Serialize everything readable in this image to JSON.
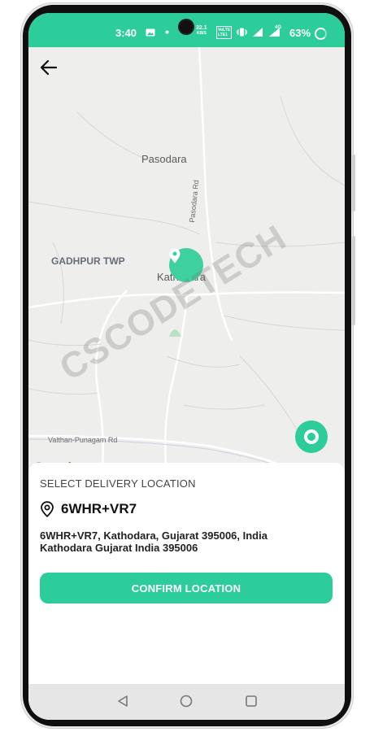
{
  "status_bar": {
    "time": "3:40",
    "network_speed_value": "32.1",
    "network_speed_unit": "KB/S",
    "volte_line1": "VoLTE",
    "volte_line2": "LTE1",
    "battery_percent": "63%",
    "icons": [
      "photo-icon",
      "dot-icon",
      "vibrate-icon",
      "signal-icon",
      "4g-signal-icon",
      "battery-ring-icon"
    ]
  },
  "map": {
    "labels": {
      "pasodara": "Pasodara",
      "pasodara_rd": "Pasodara Rd",
      "gadhpur_twp": "GADHPUR TWP",
      "kathodara": "Kathodara",
      "valthan_rd": "Valthan-Punagam Rd"
    },
    "google_logo": [
      "G",
      "o",
      "o",
      "g",
      "l",
      "e"
    ],
    "google_colors": [
      "#4285F4",
      "#EA4335",
      "#FBBC05",
      "#4285F4",
      "#34A853",
      "#EA4335"
    ],
    "watermark": "CSCODETECH"
  },
  "sheet": {
    "heading": "SELECT DELIVERY LOCATION",
    "place_name": "6WHR+VR7",
    "address": "6WHR+VR7, Kathodara, Gujarat 395006, India Kathodara Gujarat India 395006",
    "confirm_label": "CONFIRM LOCATION"
  },
  "colors": {
    "accent": "#2dcc9b",
    "map_background": "#eeeeec"
  },
  "icons": {
    "back": "back-arrow-icon",
    "pin": "location-pin-icon",
    "my_location": "my-location-icon",
    "place": "place-pin-outline-icon",
    "nav_back": "nav-back-triangle-icon",
    "nav_home": "nav-home-circle-icon",
    "nav_recents": "nav-recents-square-icon"
  }
}
